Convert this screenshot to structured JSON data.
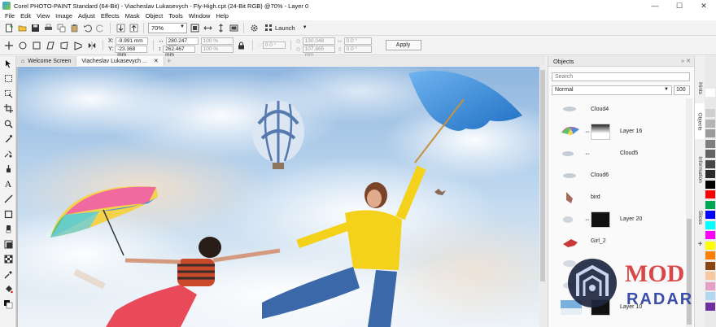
{
  "window": {
    "title": "Corel PHOTO-PAINT Standard (64-Bit) - Viacheslav Lukasevych - Fly-High.cpt (24-Bit RGB) @70% - Layer 0",
    "minimize": "—",
    "maximize": "☐",
    "close": "✕"
  },
  "menu": [
    "File",
    "Edit",
    "View",
    "Image",
    "Adjust",
    "Effects",
    "Mask",
    "Object",
    "Tools",
    "Window",
    "Help"
  ],
  "toolbar": {
    "zoom": "70%",
    "launch_label": "Launch"
  },
  "property_bar": {
    "x_label": "X:",
    "x_value": "-9.991 mm",
    "y_label": "Y:",
    "y_value": "-23.368 mm",
    "width_value": "280.247 mm",
    "height_value": "262.467 mm",
    "scale_w": "100 %",
    "scale_h": "100 %",
    "rotation": "0.0 °",
    "center_x": "130.048 mm",
    "center_y": "107.865 mm",
    "skew_h": "0.0 °",
    "skew_v": "0.0 °",
    "apply_label": "Apply"
  },
  "tabs": [
    {
      "label": "Welcome Screen"
    },
    {
      "label": "Viacheslav Lukasevych ..."
    }
  ],
  "objects_panel": {
    "title": "Objects",
    "search_placeholder": "Search",
    "blend_mode": "Normal",
    "opacity": "100",
    "layers": [
      {
        "name": "Cloud4",
        "mask": false,
        "thumb": "cloud"
      },
      {
        "name": "Layer 16",
        "mask": true,
        "thumb": "umbrella"
      },
      {
        "name": "Cloud5",
        "mask": false,
        "thumb": "cloud"
      },
      {
        "name": "Cloud6",
        "mask": false,
        "thumb": "cloud"
      },
      {
        "name": "bird",
        "mask": false,
        "thumb": "bird"
      },
      {
        "name": "Layer 20",
        "mask": true,
        "thumb": "cloud"
      },
      {
        "name": "Girl_2",
        "mask": false,
        "thumb": "girl"
      },
      {
        "name": "",
        "mask": false,
        "thumb": "cloud"
      },
      {
        "name": "",
        "mask": false,
        "thumb": "cloud"
      },
      {
        "name": "Layer 10",
        "mask": true,
        "thumb": "sky"
      }
    ]
  },
  "side_tabs": [
    "Hints",
    "Objects",
    "Information",
    "Slices"
  ],
  "palette": [
    "#ffffff",
    "#e8e8e8",
    "#cfcfcf",
    "#b5b5b5",
    "#9a9a9a",
    "#7f7f7f",
    "#636363",
    "#474747",
    "#2b2b2b",
    "#000000",
    "#ff0000",
    "#00a651",
    "#0000ff",
    "#00ffff",
    "#ff00ff",
    "#ffff00",
    "#ff7f00",
    "#8b4513",
    "#f7c8a0",
    "#e6a0c4",
    "#b0d8f0",
    "#7030a0"
  ],
  "watermark": {
    "line1": "MOD",
    "line2": "RADAR"
  }
}
